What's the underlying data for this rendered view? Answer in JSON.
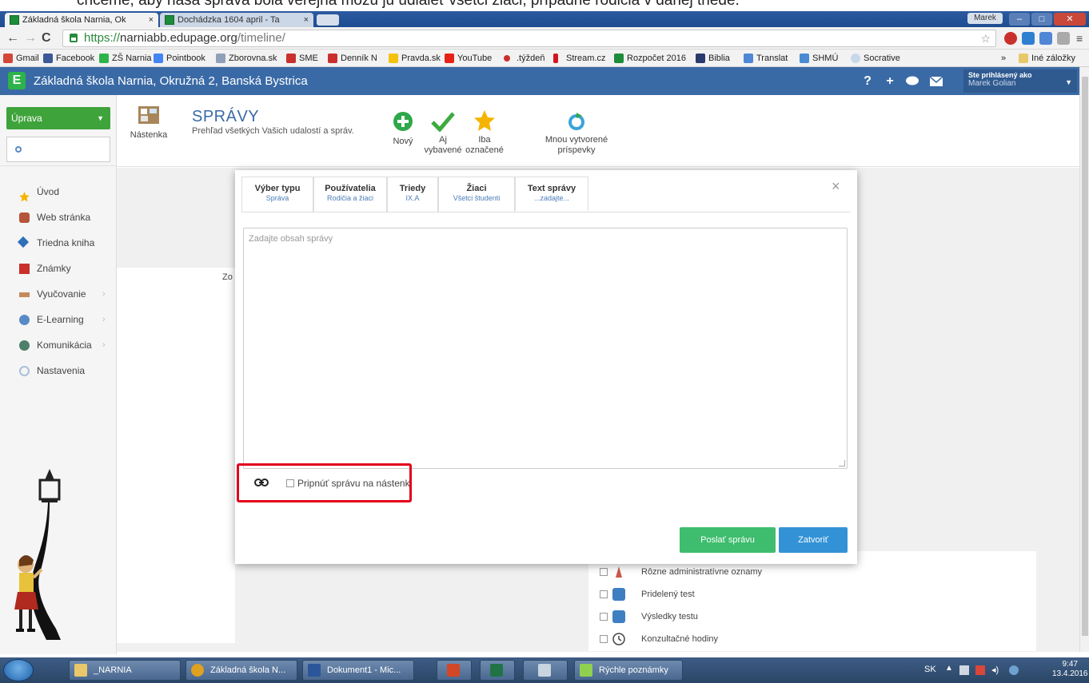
{
  "caption": "chceme, aby naša správa bola verejná môžu ju udiaieť všetci žiaci, prípadne rodičia v danej triede.",
  "browser": {
    "tabs": [
      {
        "title": "Základná škola Narnia, Ok",
        "close": "×"
      },
      {
        "title": "Dochádzka 1604 april - Ta",
        "close": "×"
      }
    ],
    "window_user": "Marek",
    "url_proto": "https://",
    "url_host": "narniabb.edupage.org",
    "url_path": "/timeline/"
  },
  "bookmarks": [
    "Gmail",
    "Facebook",
    "ZŠ Narnia",
    "Pointbook",
    "Zborovna.sk",
    "SME",
    "Denník N",
    "Pravda.sk",
    "YouTube",
    ".týždeň",
    "Stream.cz",
    "Rozpočet 2016",
    "Biblia",
    "Translat",
    "SHMÚ",
    "Socrative",
    "»",
    "Iné záložky"
  ],
  "header": {
    "logo": "E",
    "school": "Základná škola Narnia, Okružná 2, Banská Bystrica",
    "help": "?",
    "plus": "+",
    "signed_in_label": "Ste prihlásený ako",
    "user_name": "Marek Golian"
  },
  "sidebar": {
    "dropdown": "Úprava",
    "items": [
      {
        "label": "Úvod",
        "icon": "star-icon"
      },
      {
        "label": "Web stránka",
        "icon": "web-icon"
      },
      {
        "label": "Triedna kniha",
        "icon": "book-icon"
      },
      {
        "label": "Známky",
        "icon": "grades-icon"
      },
      {
        "label": "Vyučovanie",
        "icon": "teaching-icon"
      },
      {
        "label": "E-Learning",
        "icon": "elearning-icon"
      },
      {
        "label": "Komunikácia",
        "icon": "communication-icon"
      },
      {
        "label": "Nastavenia",
        "icon": "settings-icon"
      }
    ]
  },
  "toolbar": {
    "board": "Nástenka",
    "title": "SPRÁVY",
    "subtitle": "Prehľad všetkých Vašich udalostí a správ.",
    "new": "Nový",
    "done_1": "Aj",
    "done_2": "vybavené",
    "marked_1": "Iba",
    "marked_2": "označené",
    "mine_1": "Mnou vytvorené",
    "mine_2": "príspevky"
  },
  "background": {
    "partial_text": "Zo",
    "rows": [
      "Rôzne administratívne oznamy",
      "Pridelený test",
      "Výsledky testu",
      "Konzultačné hodiny"
    ]
  },
  "modal": {
    "tabs": [
      {
        "title": "Výber typu",
        "sub": "Správa"
      },
      {
        "title": "Používatelia",
        "sub": "Rodičia a žiaci"
      },
      {
        "title": "Triedy",
        "sub": "IX.A"
      },
      {
        "title": "Žiaci",
        "sub": "Všetci študenti"
      },
      {
        "title": "Text správy",
        "sub": "...zadajte..."
      }
    ],
    "close": "×",
    "placeholder": "Zadajte obsah správy",
    "pin_label": "Pripnúť správu na nástenk",
    "send": "Poslať správu",
    "close_btn": "Zatvoriť"
  },
  "taskbar": {
    "items": [
      "_NARNIA",
      "Základná škola N...",
      "Dokument1 - Mic...",
      "",
      "",
      "",
      "Rýchle poznámky"
    ],
    "lang": "SK",
    "time": "9:47",
    "date": "13.4.2016"
  },
  "colors": {
    "header": "#3a6aa6",
    "green": "#3fa33b",
    "send": "#3ebd6e",
    "close": "#3392d6",
    "highlight": "#e3001b"
  }
}
